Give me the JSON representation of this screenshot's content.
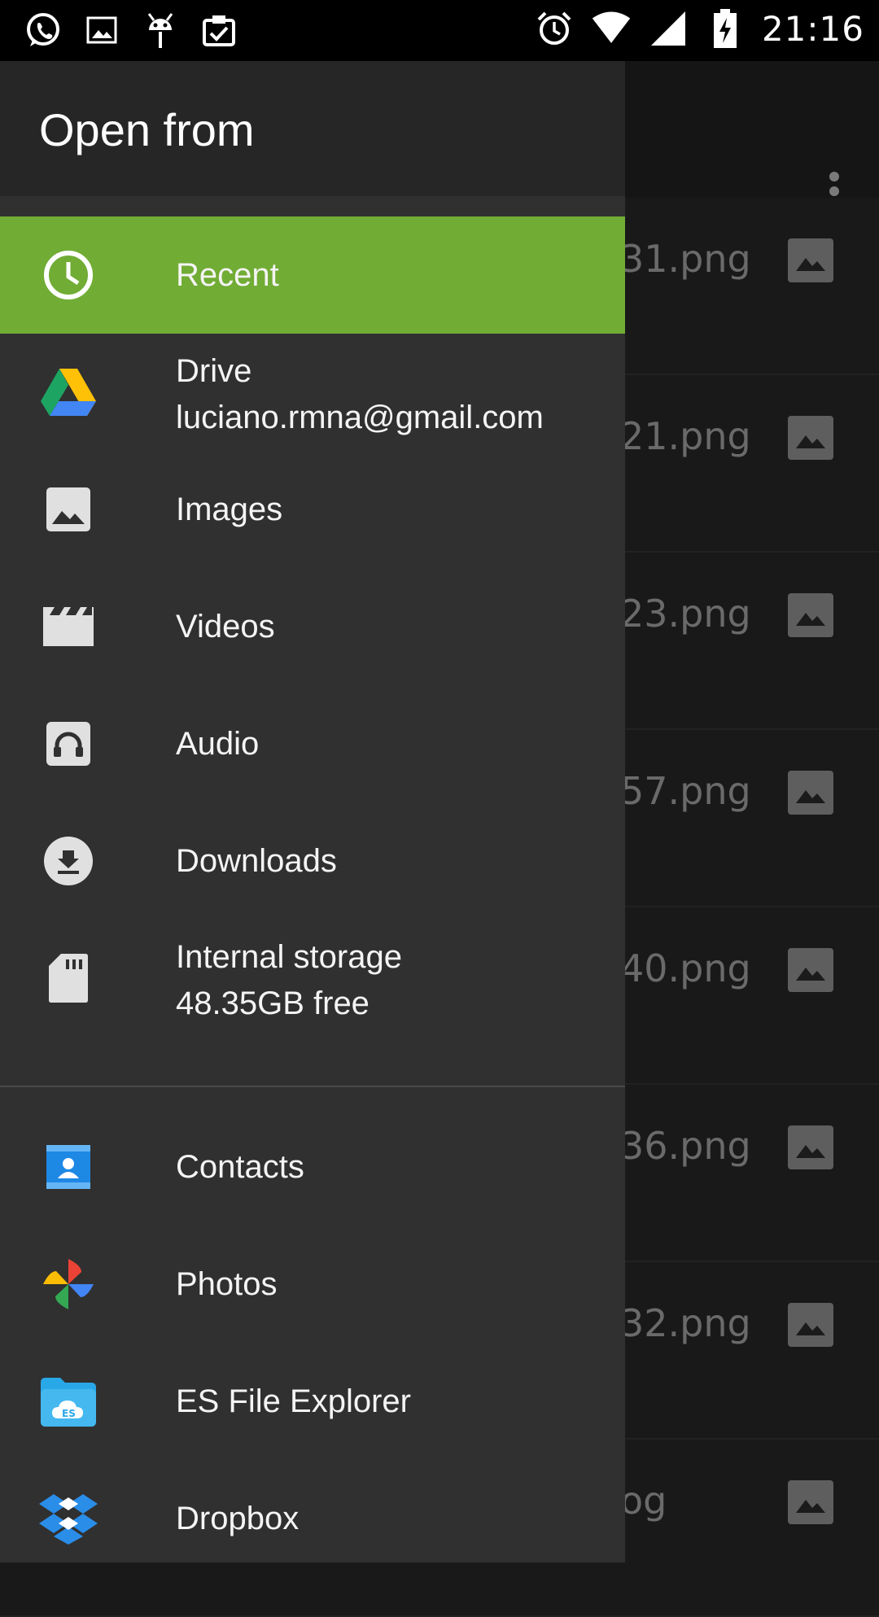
{
  "status_bar": {
    "time": "21:16",
    "left_icons": [
      "whatsapp-icon",
      "image-icon",
      "android-debug-icon",
      "clipboard-check-icon"
    ],
    "right_icons": [
      "alarm-icon",
      "wifi-icon",
      "signal-icon",
      "battery-charging-icon"
    ]
  },
  "drawer": {
    "title": "Open from",
    "items": [
      {
        "label": "Recent",
        "icon": "clock-icon",
        "active": true
      },
      {
        "label": "Drive",
        "sublabel": "luciano.rmna@gmail.com",
        "icon": "google-drive-icon"
      },
      {
        "label": "Images",
        "icon": "image-icon"
      },
      {
        "label": "Videos",
        "icon": "video-clapper-icon"
      },
      {
        "label": "Audio",
        "icon": "headphones-icon"
      },
      {
        "label": "Downloads",
        "icon": "download-icon"
      },
      {
        "label": "Internal storage",
        "sublabel": "48.35GB free",
        "icon": "sd-card-icon"
      }
    ],
    "apps": [
      {
        "label": "Contacts",
        "icon": "contacts-icon"
      },
      {
        "label": "Photos",
        "icon": "google-photos-icon"
      },
      {
        "label": "ES File Explorer",
        "icon": "es-file-explorer-icon"
      },
      {
        "label": "Dropbox",
        "icon": "dropbox-icon"
      }
    ]
  },
  "background_list": {
    "items": [
      "31.png",
      "21.png",
      "23.png",
      "57.png",
      "40.png",
      "36.png",
      "32.png",
      "og"
    ]
  },
  "colors": {
    "active_item": "#71ac35",
    "drawer_bg": "#303030",
    "status_bar": "#000000"
  }
}
